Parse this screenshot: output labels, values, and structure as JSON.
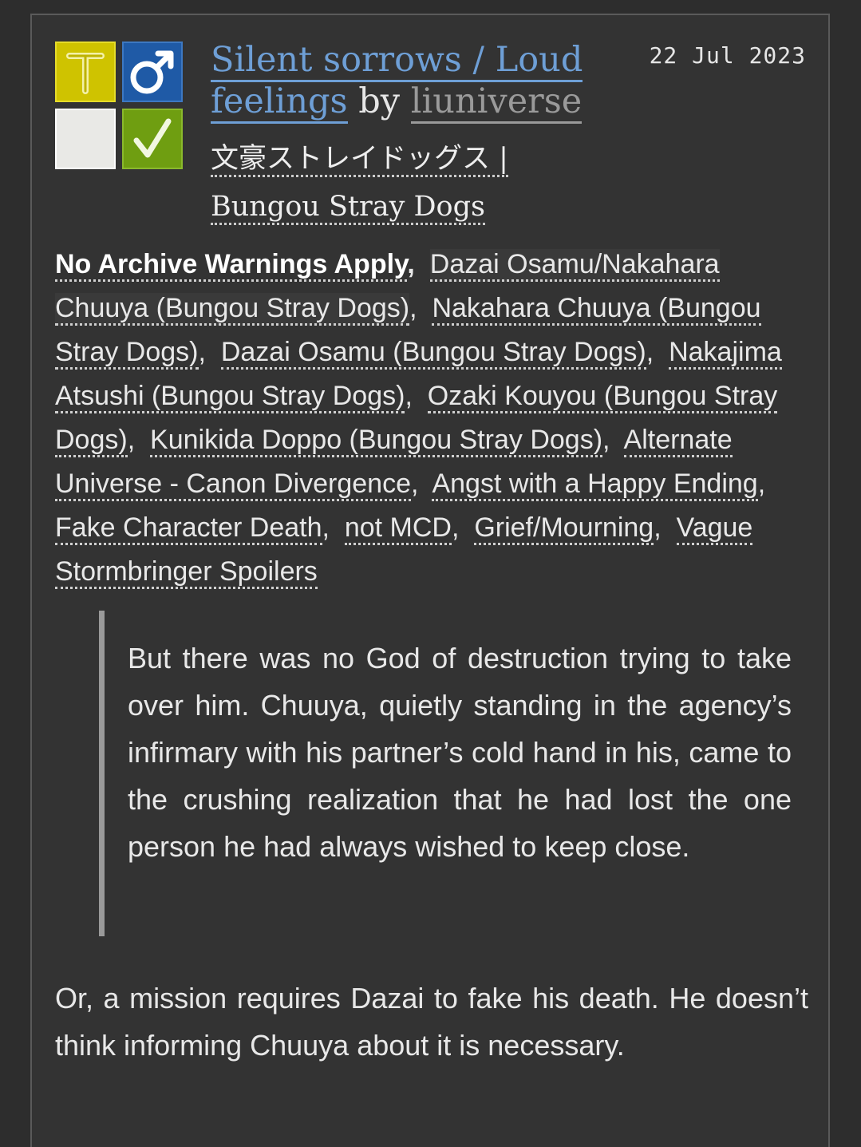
{
  "icons": {
    "rating": {
      "glyph": "T",
      "name": "rating-teen-icon",
      "color": "#cfc300"
    },
    "category": {
      "glyph": "♂",
      "name": "category-mm-icon",
      "color": "#1f5aa6"
    },
    "warning": {
      "glyph": "",
      "name": "warnings-none-icon",
      "color": "#e9e9e6"
    },
    "complete": {
      "glyph": "✓",
      "name": "complete-check-icon",
      "color": "#6f9e11"
    }
  },
  "work": {
    "title": "Silent sorrows / Loud feelings",
    "by": "by",
    "author": "liuniverse",
    "date": "22 Jul 2023",
    "fandom": "文豪ストレイドッグス | Bungou Stray Dogs"
  },
  "tags": [
    {
      "label": "No Archive Warnings Apply",
      "type": "warning"
    },
    {
      "label": "Dazai Osamu/Nakahara Chuuya (Bungou Stray Dogs)",
      "type": "relationship"
    },
    {
      "label": "Nakahara Chuuya (Bungou Stray Dogs)",
      "type": "character"
    },
    {
      "label": "Dazai Osamu (Bungou Stray Dogs)",
      "type": "character"
    },
    {
      "label": "Nakajima Atsushi (Bungou Stray Dogs)",
      "type": "character"
    },
    {
      "label": "Ozaki Kouyou (Bungou Stray Dogs)",
      "type": "character"
    },
    {
      "label": "Kunikida Doppo (Bungou Stray Dogs)",
      "type": "character"
    },
    {
      "label": "Alternate Universe - Canon Divergence",
      "type": "freeform"
    },
    {
      "label": "Angst with a Happy Ending",
      "type": "freeform"
    },
    {
      "label": "Fake Character Death",
      "type": "freeform"
    },
    {
      "label": "not MCD",
      "type": "freeform"
    },
    {
      "label": "Grief/Mourning",
      "type": "freeform"
    },
    {
      "label": "Vague Stormbringer Spoilers",
      "type": "freeform"
    }
  ],
  "summary": {
    "quote": "But there was no God of destruction trying to take over him. Chuuya, quietly standing in the agency’s infirmary with his partner’s cold hand in his, came to the crushing realization that he had lost the one person he had always wished to keep close.",
    "text": "Or, a mission requires Dazai to fake his death. He doesn’t think informing Chuuya about it is necessary."
  }
}
